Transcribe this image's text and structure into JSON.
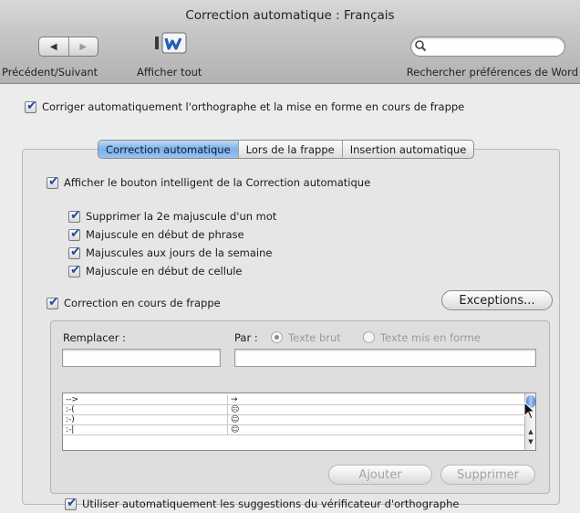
{
  "window": {
    "title": "Correction automatique : Français"
  },
  "toolbar": {
    "back_glyph": "◀",
    "forward_glyph": "▶",
    "nav_label": "Précédent/Suivant",
    "show_all_label": "Afficher tout",
    "search_placeholder": "",
    "search_label": "Rechercher préférences de Word"
  },
  "main_option": {
    "label": "Corriger automatiquement l'orthographe et la mise en forme en cours de frappe",
    "checked": true
  },
  "tabs": [
    {
      "label": "Correction automatique",
      "active": true
    },
    {
      "label": "Lors de la frappe",
      "active": false
    },
    {
      "label": "Insertion automatique",
      "active": false
    }
  ],
  "options": {
    "smart_button": "Afficher le bouton intelligent de la Correction automatique",
    "sub": [
      "Supprimer la 2e majuscule d'un mot",
      "Majuscule en début de phrase",
      "Majuscules aux jours de la semaine",
      "Majuscule en début de cellule"
    ],
    "typing_correction": "Correction en cours de frappe",
    "use_suggestions": "Utiliser automatiquement les suggestions du vérificateur d'orthographe"
  },
  "buttons": {
    "exceptions": "Exceptions...",
    "add": "Ajouter",
    "delete": "Supprimer"
  },
  "replace": {
    "replace_label": "Remplacer :",
    "with_label": "Par :",
    "radio_plain": "Texte brut",
    "radio_formatted": "Texte mis en forme",
    "replace_value": "",
    "with_value": ""
  },
  "entries": [
    {
      "from": "-->",
      "to": "→"
    },
    {
      "from": ":-(",
      "to": "☹"
    },
    {
      "from": ":-)",
      "to": "☺"
    },
    {
      "from": ":-|",
      "to": "☺"
    }
  ],
  "colors": {
    "accent": "#1e4fa8",
    "tab_active": "#7db1e8"
  }
}
